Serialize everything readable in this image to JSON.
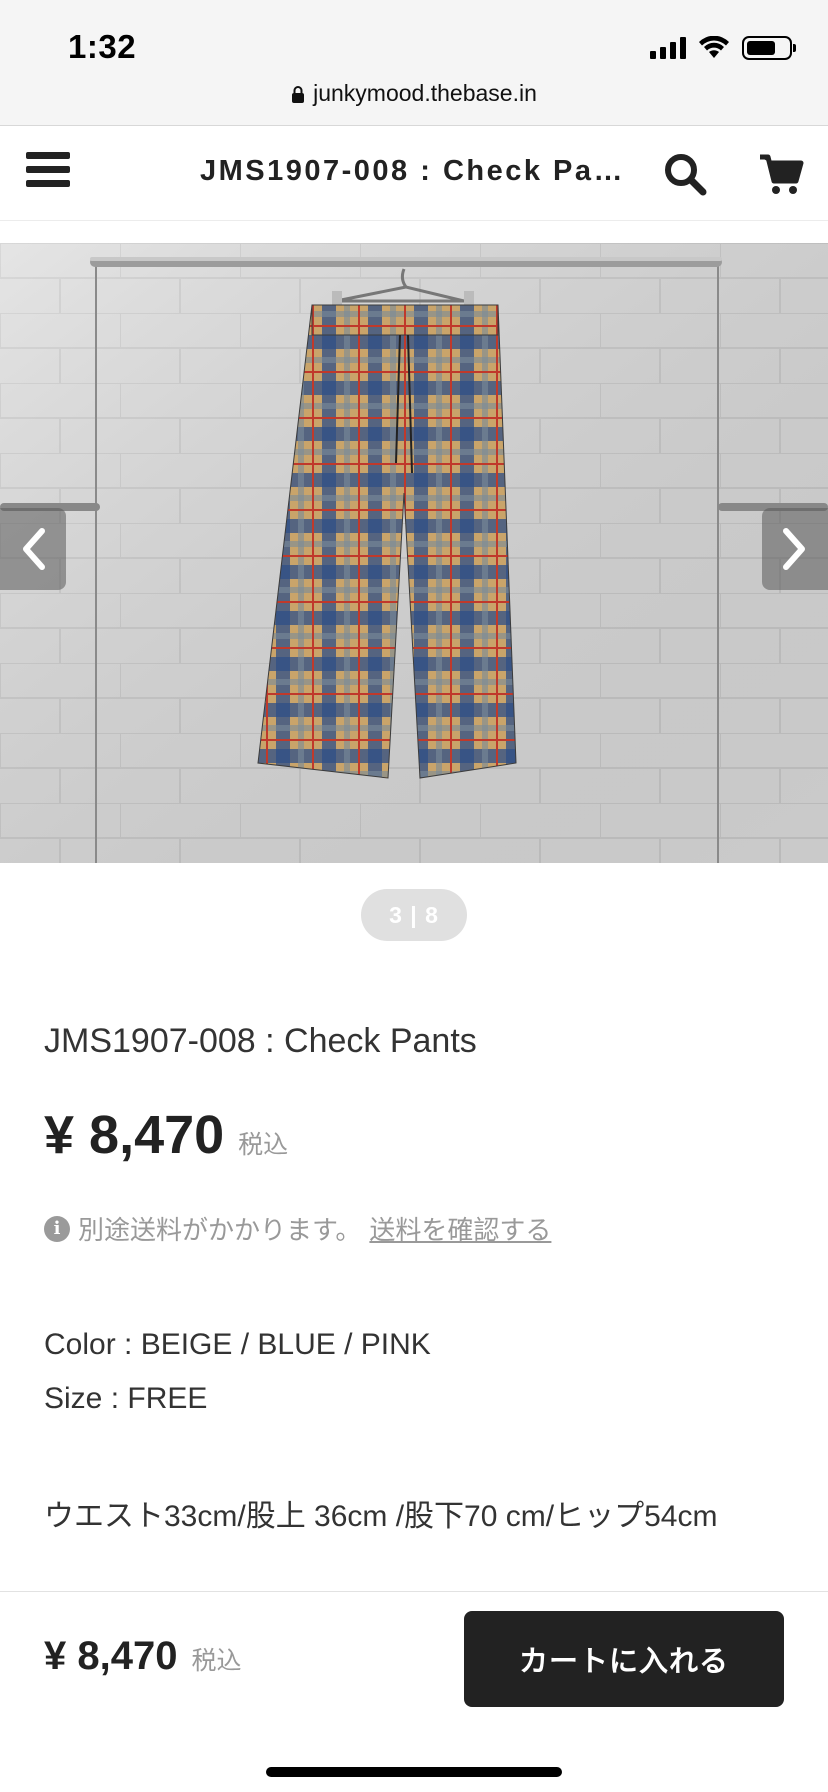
{
  "status_bar": {
    "time": "1:32",
    "url": "junkymood.thebase.in",
    "icons": [
      "signal-icon",
      "wifi-icon",
      "battery-icon",
      "lock-icon"
    ]
  },
  "header": {
    "title": "JMS1907-008 : Check Pants",
    "icons": [
      "hamburger-menu-icon",
      "search-icon",
      "cart-icon"
    ]
  },
  "gallery": {
    "counter": "3 | 8",
    "image_description_icon": "check-pants-photo",
    "nav_icons": [
      "chevron-left-icon",
      "chevron-right-icon"
    ]
  },
  "product": {
    "title": "JMS1907-008 : Check Pants",
    "price": "¥ 8,470",
    "tax_label": "税込",
    "shipping_note": "別途送料がかかります。",
    "shipping_link": "送料を確認する",
    "color": "Color : BEIGE / BLUE / PINK",
    "size": "Size : FREE",
    "measurements": "ウエスト33cm/股上 36cm /股下70 cm/ヒップ54cm"
  },
  "bottom_bar": {
    "price": "¥ 8,470",
    "tax_label": "税込",
    "add_to_cart": "カートに入れる"
  },
  "colors": {
    "accent_dark": "#222222",
    "muted_text": "#999999"
  }
}
